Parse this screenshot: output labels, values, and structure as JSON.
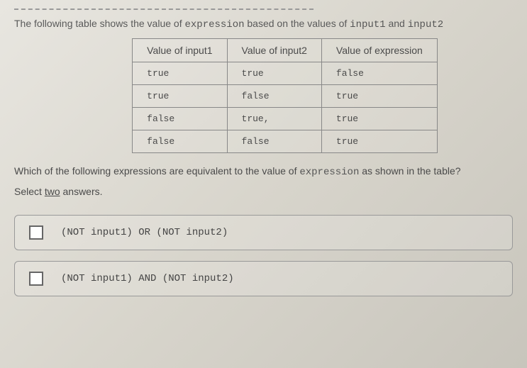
{
  "intro": {
    "prefix": "The following table shows the value of ",
    "code1": "expression",
    "middle": " based on the values of ",
    "code2": "input1",
    "and": " and ",
    "code3": "input2"
  },
  "table": {
    "headers": [
      "Value of input1",
      "Value of input2",
      "Value of expression"
    ],
    "rows": [
      [
        "true",
        "true",
        "false"
      ],
      [
        "true",
        "false",
        "true"
      ],
      [
        "false",
        "true,",
        "true"
      ],
      [
        "false",
        "false",
        "true"
      ]
    ]
  },
  "question": {
    "prefix": "Which of the following expressions are equivalent to the value of ",
    "code": "expression",
    "suffix": " as shown in the table?"
  },
  "select": {
    "prefix": "Select ",
    "underlined": "two",
    "suffix": " answers."
  },
  "options": [
    "(NOT input1) OR (NOT input2)",
    "(NOT input1) AND (NOT input2)"
  ],
  "chart_data": {
    "type": "table",
    "title": "Truth table for expression based on input1 and input2",
    "columns": [
      "Value of input1",
      "Value of input2",
      "Value of expression"
    ],
    "rows": [
      {
        "input1": "true",
        "input2": "true",
        "expression": "false"
      },
      {
        "input1": "true",
        "input2": "false",
        "expression": "true"
      },
      {
        "input1": "false",
        "input2": "true",
        "expression": "true"
      },
      {
        "input1": "false",
        "input2": "false",
        "expression": "true"
      }
    ]
  }
}
